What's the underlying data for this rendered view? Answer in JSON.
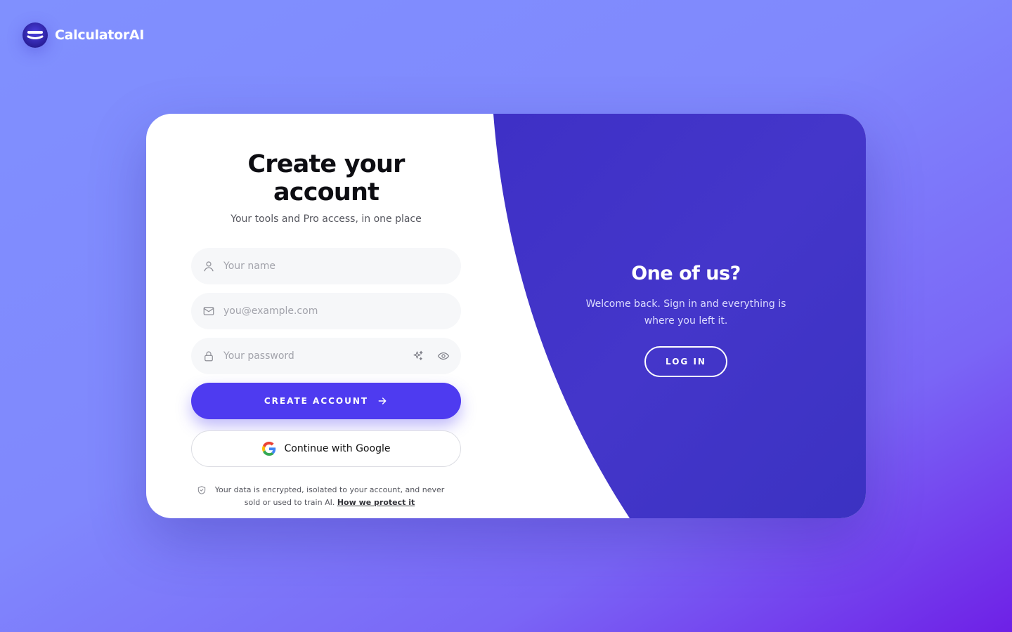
{
  "brand": {
    "name": "CalculatorAI"
  },
  "form": {
    "title": "Create your account",
    "subtitle": "Your tools and Pro access, in one place",
    "name_placeholder": "Your name",
    "email_placeholder": "you@example.com",
    "password_placeholder": "Your password",
    "create_label": "CREATE ACCOUNT",
    "google_label": "Continue with Google",
    "privacy_text": "Your data is encrypted, isolated to your account, and never sold or used to train AI.",
    "privacy_link": "How we protect it"
  },
  "side": {
    "title": "One of us?",
    "text": "Welcome back. Sign in and everything is where you left it.",
    "login_label": "LOG IN"
  },
  "colors": {
    "accent": "#4e3bf0",
    "panel": "#3b2fc4",
    "background": "#8090fe"
  }
}
